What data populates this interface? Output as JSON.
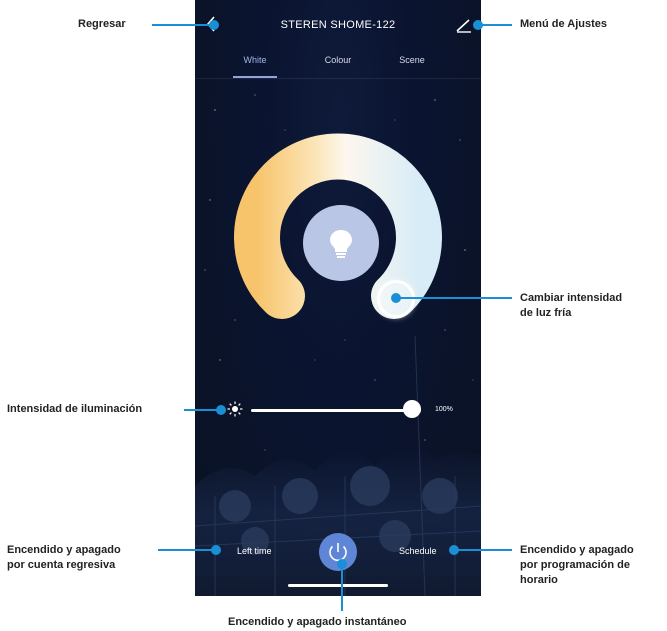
{
  "screen": {
    "title": "STEREN SHOME-122",
    "back_icon": "chevron-left-icon",
    "edit_icon": "edit-pencil-icon",
    "tabs": [
      {
        "label": "White",
        "active": true
      },
      {
        "label": "Colour",
        "active": false
      },
      {
        "label": "Scene",
        "active": false
      }
    ],
    "brightness": {
      "value_percent": 100,
      "label": "100%",
      "icon": "sun-icon"
    },
    "bulb_icon": "lightbulb-icon",
    "bottom": {
      "left_label": "Left time",
      "right_label": "Schedule",
      "power_icon": "power-icon"
    },
    "colors": {
      "warm": "#f7c46b",
      "cool": "#d8ecf7",
      "power": "#5f86d6",
      "tab_active": "#9fb6e6"
    }
  },
  "annotations": {
    "back": "Regresar",
    "settings": "Menú de Ajustes",
    "cold_light": [
      "Cambiar intensidad",
      "de luz fría"
    ],
    "brightness": "Intensidad de iluminación",
    "countdown": [
      "Encendido y apagado",
      "por cuenta regresiva"
    ],
    "schedule": [
      "Encendido y apagado",
      "por programación de",
      "horario"
    ],
    "instant": "Encendido y apagado instantáneo"
  }
}
